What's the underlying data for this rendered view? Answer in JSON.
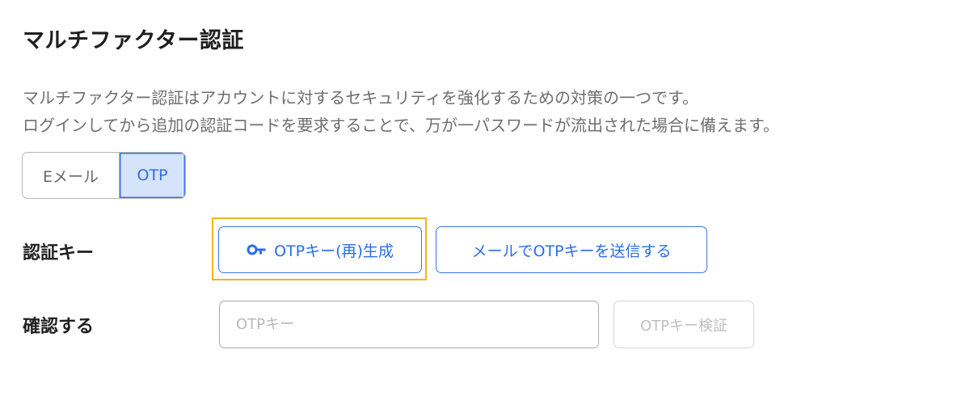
{
  "title": "マルチファクター認証",
  "description": {
    "line1": "マルチファクター認証はアカウントに対するセキュリティを強化するための対策の一つです。",
    "line2": "ログインしてから追加の認証コードを要求することで、万が一パスワードが流出された場合に備えます。"
  },
  "method_tabs": {
    "email_label": "Eメール",
    "otp_label": "OTP",
    "selected": "OTP"
  },
  "auth_key": {
    "label": "認証キー",
    "generate_button": "OTPキー(再)生成",
    "generate_icon": "key-icon",
    "send_email_button": "メールでOTPキーを送信する"
  },
  "confirm": {
    "label": "確認する",
    "input_placeholder": "OTPキー",
    "input_value": "",
    "verify_button": "OTPキー検証"
  },
  "colors": {
    "accent": "#2b6de8",
    "accent_bg": "#d6e4fb",
    "highlight": "#f2b51e",
    "muted_text": "#6e6e6e",
    "disabled_text": "#bfbfbf"
  }
}
